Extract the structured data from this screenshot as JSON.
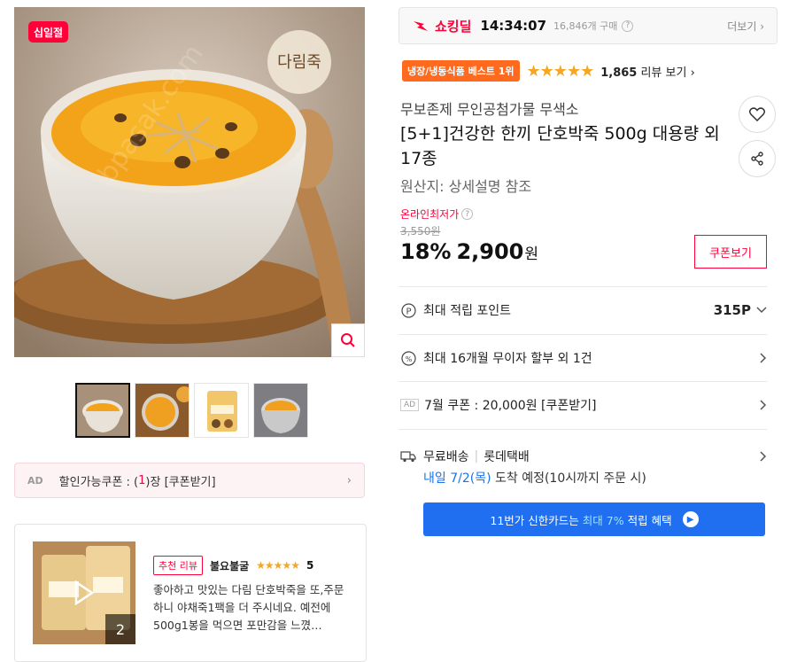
{
  "gallery": {
    "badge": "십일절",
    "watermark": "bpasak.com",
    "thumb_count_label": "2",
    "brand_text": "다림죽"
  },
  "ad_coupon": {
    "ad_tag": "AD",
    "text_prefix": "할인가능쿠폰 : (",
    "count": "1",
    "text_suffix": ")장 [쿠폰받기]"
  },
  "review_preview": {
    "tag": "추천 리뷰",
    "reviewer": "불요불굴",
    "stars": "★★★★★",
    "score": "5",
    "text": "좋아하고 맛있는 다림 단호박죽을 또,주문하니 야채죽1팩을 더 주시네요. 예전에 500g1봉을 먹으면 포만감을 느꼈…",
    "media_count": "2"
  },
  "deal": {
    "label": "쇼킹딜",
    "time": "14:34:07",
    "buy_count": "16,846개 구매",
    "more": "더보기 ›"
  },
  "product": {
    "best_badge": "냉장/냉동식품 베스트 1위",
    "stars": "★★★★★",
    "review_count": "1,865",
    "review_label": " 리뷰 보기 ›",
    "seller_tagline": "무보존제 무인공첨가물 무색소",
    "title": "[5+1]건강한 한끼 단호박죽 500g 대용량 외 17종",
    "origin": "원산지:  상세설명 참조"
  },
  "price": {
    "lowest_label": "온라인최저가",
    "original": "3,550원",
    "discount": "18%",
    "sale": "2,900",
    "unit": "원",
    "coupon_button": "쿠폰보기"
  },
  "benefits": {
    "points_label": "최대 적립 포인트",
    "points_value": "315P",
    "installment": "최대 16개월 무이자 할부 외 1건",
    "coupon_ad": "AD",
    "coupon_text": "7월 쿠폰 : 20,000원 [쿠폰받기]",
    "shipping": "무료배송",
    "courier": "롯데택배",
    "delivery_date": "내일 7/2(목)",
    "delivery_rest": " 도착 예정(10시까지 주문 시)",
    "card_prefix": "11번가 신한카드는",
    "card_highlight": "최대 7%",
    "card_suffix": "적립 혜택"
  }
}
